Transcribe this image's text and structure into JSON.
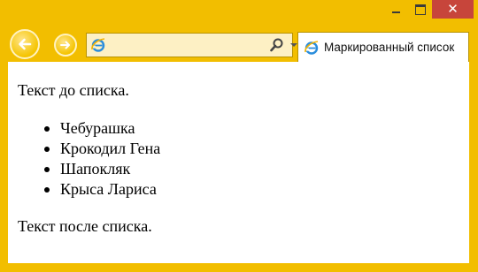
{
  "browser": {
    "address": {
      "value": ""
    },
    "tab": {
      "label": "Маркированный список"
    }
  },
  "page": {
    "text_before": "Текст до списка.",
    "list_items": [
      "Чебурашка",
      "Крокодил Гена",
      "Шапокляк",
      "Крыса Лариса"
    ],
    "text_after": "Текст после списка."
  },
  "colors": {
    "frame": "#f2be00",
    "close_button": "#c7453b",
    "address_bg": "#fdf0c4",
    "content_bg": "#ffffff"
  },
  "icons": [
    "minimize-icon",
    "maximize-icon",
    "close-icon",
    "back-arrow-icon",
    "forward-arrow-icon",
    "ie-logo-icon",
    "search-icon",
    "dropdown-arrow-icon",
    "refresh-icon"
  ]
}
